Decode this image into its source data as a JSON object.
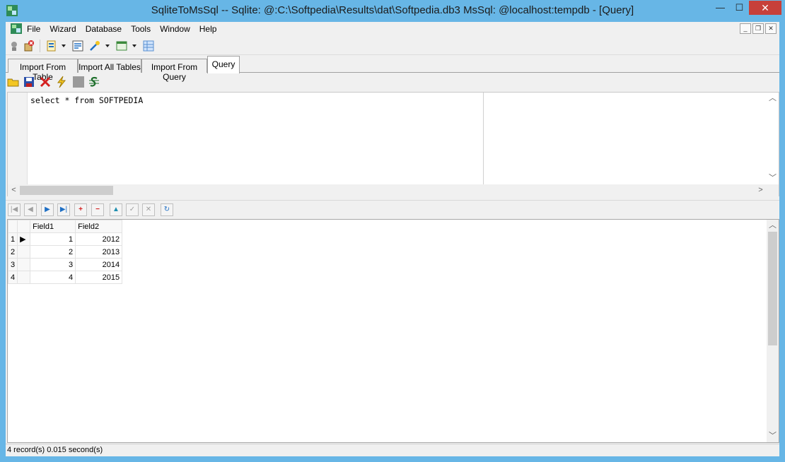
{
  "window": {
    "title": "SqliteToMsSql -- Sqlite: @:C:\\Softpedia\\Results\\dat\\Softpedia.db3 MsSql: @localhost:tempdb - [Query]",
    "buttons": {
      "minimize": "—",
      "maximize": "☐",
      "close": "✕"
    }
  },
  "menu": {
    "items": [
      "File",
      "Wizard",
      "Database",
      "Tools",
      "Window",
      "Help"
    ],
    "mdi": {
      "minimize": "_",
      "restore": "❐",
      "close": "✕"
    }
  },
  "tabs": [
    {
      "label": "Import From Table",
      "active": false
    },
    {
      "label": "Import All Tables",
      "active": false
    },
    {
      "label": "Import From Query",
      "active": false
    },
    {
      "label": "Query",
      "active": true
    }
  ],
  "editor": {
    "sql": "select * from SOFTPEDIA"
  },
  "navigator": {
    "buttons": [
      "first",
      "prior",
      "next",
      "last",
      "insert",
      "delete",
      "edit",
      "post",
      "cancel",
      "refresh"
    ]
  },
  "grid": {
    "columns": [
      "Field1",
      "Field2"
    ],
    "rows": [
      {
        "n": "1",
        "f1": "1",
        "f2": "2012",
        "current": true
      },
      {
        "n": "2",
        "f1": "2",
        "f2": "2013",
        "current": false
      },
      {
        "n": "3",
        "f1": "3",
        "f2": "2014",
        "current": false
      },
      {
        "n": "4",
        "f1": "4",
        "f2": "2015",
        "current": false
      }
    ]
  },
  "status": {
    "text": "4 record(s)  0.015 second(s)"
  },
  "colors": {
    "frame": "#67b6e6",
    "close": "#c7403a",
    "accent_blue": "#1f6fc4",
    "delete_red": "#d42020"
  }
}
